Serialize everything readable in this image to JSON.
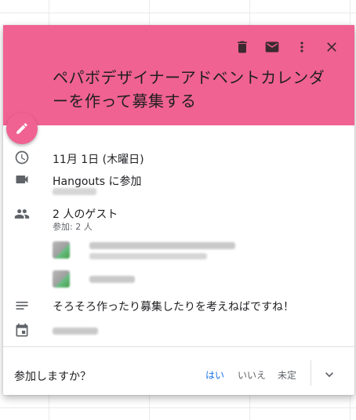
{
  "theme": {
    "header_color": "#f06292",
    "accent": "#1a73e8"
  },
  "header": {
    "actions": [
      {
        "icon": "delete-icon"
      },
      {
        "icon": "email-icon"
      },
      {
        "icon": "more-vert-icon"
      },
      {
        "icon": "close-icon"
      }
    ],
    "title": "ペパボデザイナーアドベントカレンダーを作って募集する"
  },
  "edit_button": {
    "icon": "pencil-icon"
  },
  "details": {
    "date": "11月 1日 (木曜日)",
    "hangouts": "Hangouts に参加",
    "guests_title": "2 人のゲスト",
    "guests_sub": "参加: 2 人",
    "description": "そろそろ作ったり募集したりを考えねばですね！"
  },
  "rsvp": {
    "question": "参加しますか？",
    "yes": "はい",
    "no": "いいえ",
    "maybe": "未定"
  }
}
